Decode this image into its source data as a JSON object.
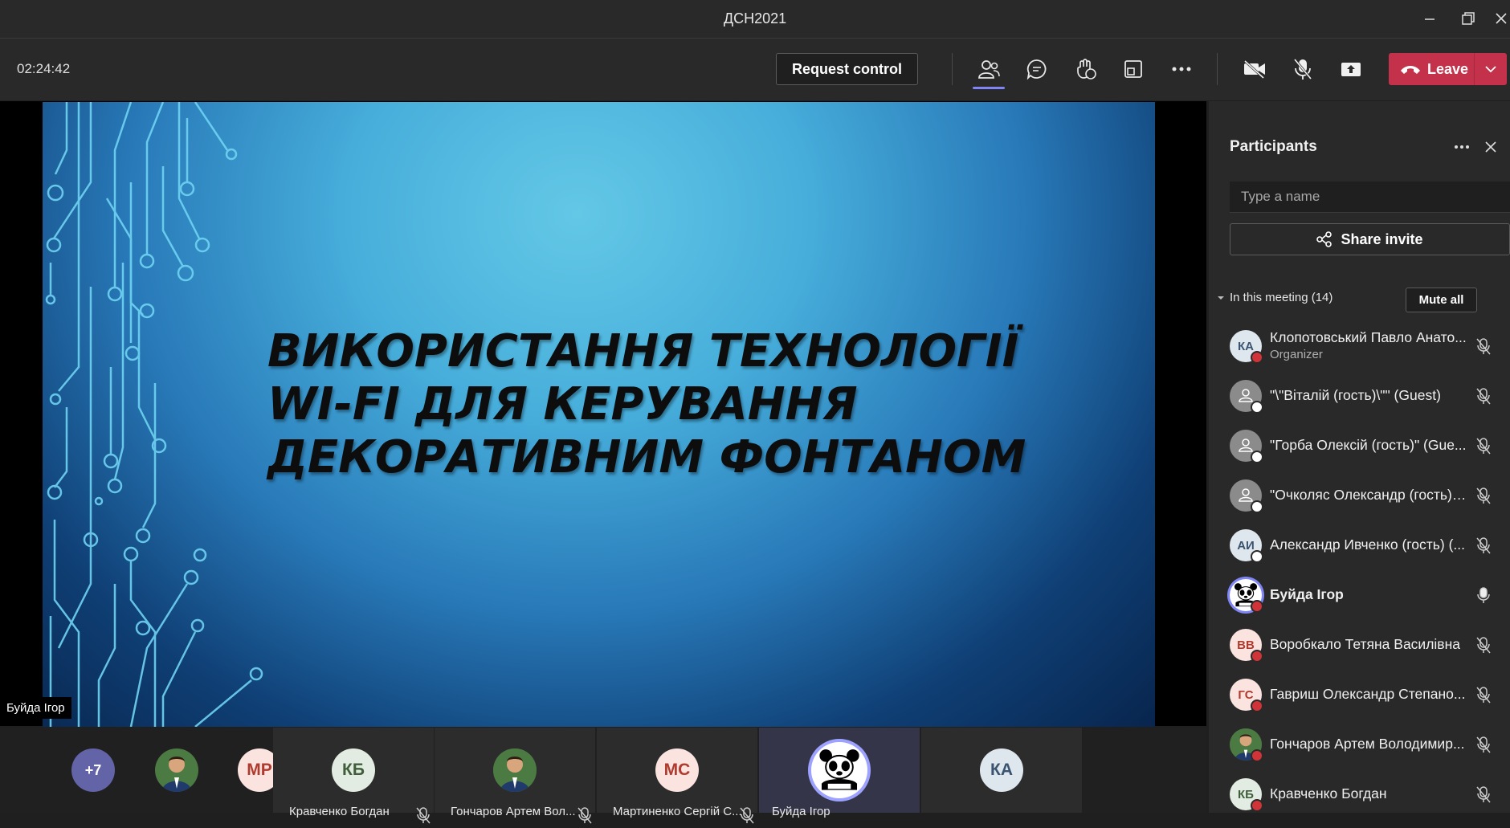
{
  "window": {
    "title": "ДСН2021"
  },
  "toolbar": {
    "timer": "02:24:42",
    "request_control": "Request control",
    "leave_label": "Leave",
    "icons": [
      "participants-icon",
      "chat-icon",
      "reactions-icon",
      "rooms-icon",
      "more-icon",
      "camera-off-icon",
      "mic-off-icon",
      "share-icon",
      "phone-icon"
    ]
  },
  "slide": {
    "title_lines": [
      "ВИКОРИСТАННЯ ТЕХНОЛОГІЇ",
      "WI-FI ДЛЯ КЕРУВАННЯ",
      "ДЕКОРАТИВНИМ ФОНТАНОМ"
    ],
    "speaker": "Буйда Ігор"
  },
  "participants": {
    "title": "Participants",
    "search_placeholder": "Type a name",
    "share_invite": "Share invite",
    "section_label": "In this meeting (14)",
    "mute_all": "Mute all",
    "list": [
      {
        "initials": "КА",
        "name": "Клопотовський Павло Анато...",
        "role": "Organizer",
        "avatar_color": "#dfe7ee",
        "text_color": "#3a5470",
        "status": "busy",
        "mic": "muted"
      },
      {
        "initials": "",
        "name": "\"\\\"Віталій (гость)\\\"\" (Guest)",
        "role": "",
        "avatar_color": "#8b8b8b",
        "text_color": "#ffffff",
        "status": "guest",
        "mic": "muted"
      },
      {
        "initials": "",
        "name": "\"Горба Олексій (гость)\" (Gue...",
        "role": "",
        "avatar_color": "#8b8b8b",
        "text_color": "#ffffff",
        "status": "guest",
        "mic": "muted"
      },
      {
        "initials": "",
        "name": "\"Очколяс Олександр (гость)\"...",
        "role": "",
        "avatar_color": "#8b8b8b",
        "text_color": "#ffffff",
        "status": "guest",
        "mic": "muted"
      },
      {
        "initials": "АИ",
        "name": "Александр Ивченко (гость) (...",
        "role": "",
        "avatar_color": "#dfe7ee",
        "text_color": "#3a5470",
        "status": "guest",
        "mic": "muted"
      },
      {
        "initials": "",
        "name": "Буйда Ігор",
        "role": "",
        "avatar_color": "#ffffff",
        "text_color": "#000000",
        "status": "busy",
        "mic": "on",
        "bold": true
      },
      {
        "initials": "ВВ",
        "name": "Воробкало Тетяна Василівна",
        "role": "",
        "avatar_color": "#fbe3e0",
        "text_color": "#b03a2e",
        "status": "busy",
        "mic": "muted"
      },
      {
        "initials": "ГС",
        "name": "Гавриш Олександр Степано...",
        "role": "",
        "avatar_color": "#fbe3e0",
        "text_color": "#b03a2e",
        "status": "busy",
        "mic": "muted"
      },
      {
        "initials": "",
        "name": "Гончаров Артем Володимир...",
        "role": "",
        "avatar_color": "#3f6b3a",
        "text_color": "#ffffff",
        "status": "busy",
        "mic": "muted"
      },
      {
        "initials": "КБ",
        "name": "Кравченко Богдан",
        "role": "",
        "avatar_color": "#e3ece2",
        "text_color": "#3f5e3a",
        "status": "busy",
        "mic": "muted"
      }
    ]
  },
  "strip": {
    "overflow": "+7",
    "mini": [
      {
        "initials": "",
        "kind": "photo"
      },
      {
        "initials": "МР",
        "color": "#fbe3e0",
        "text": "#b03a2e"
      }
    ],
    "tiles": [
      {
        "initials": "КБ",
        "name": "Кравченко Богдан",
        "color": "#e3ece2",
        "text": "#3f5e3a"
      },
      {
        "initials": "",
        "name": "Гончаров Артем Вол...",
        "color": "#3f6b3a",
        "text": "#ffffff"
      },
      {
        "initials": "МС",
        "name": "Мартиненко Сергій С...",
        "color": "#fbe3e0",
        "text": "#b03a2e"
      },
      {
        "initials": "",
        "name": "Буйда Ігор",
        "color": "#ffffff",
        "text": "#000000"
      },
      {
        "initials": "КА",
        "name": "",
        "color": "#dfe7ee",
        "text": "#3a5470"
      }
    ]
  },
  "colors": {
    "accent": "#7f85f5",
    "leave": "#c4314b",
    "busy": "#d13438"
  }
}
